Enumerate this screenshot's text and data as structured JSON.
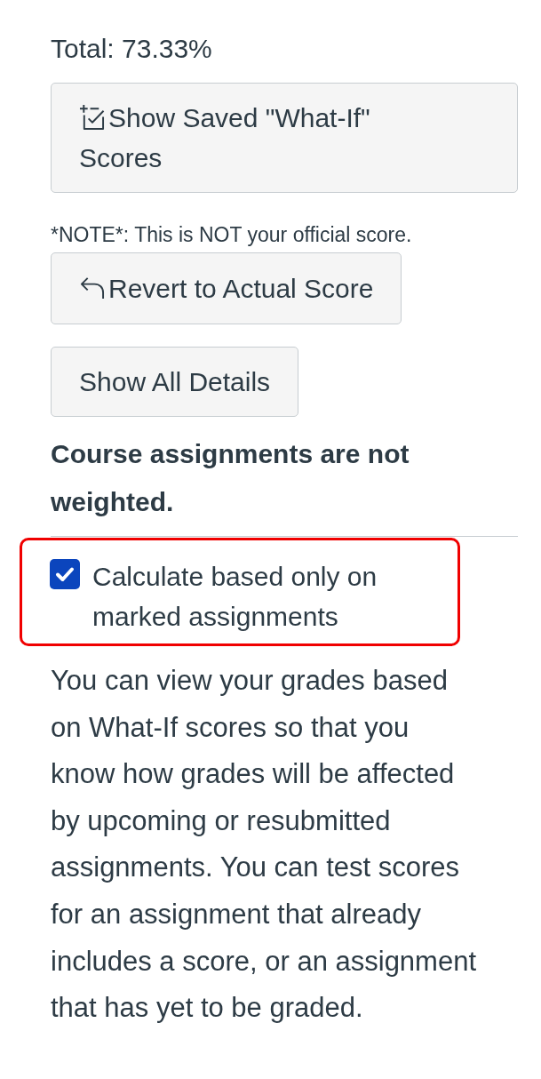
{
  "total": "Total: 73.33%",
  "what_if_button": {
    "label": "Show Saved \"What-If\" Scores"
  },
  "note": "*NOTE*: This is NOT your official score.",
  "revert_button": {
    "label": "Revert to Actual Score"
  },
  "details_button": {
    "label": "Show All Details"
  },
  "weighting_notice": "Course assignments are not weighted.",
  "marked_only_option": {
    "label": "Calculate based only on marked assignments",
    "checked": true,
    "highlighted": true
  },
  "description": "You can view your grades based on What-If scores so that you know how grades will be affected by upcoming or resubmitted assignments. You can test scores for an assignment that already includes a score, or an assignment that has yet to be graded."
}
